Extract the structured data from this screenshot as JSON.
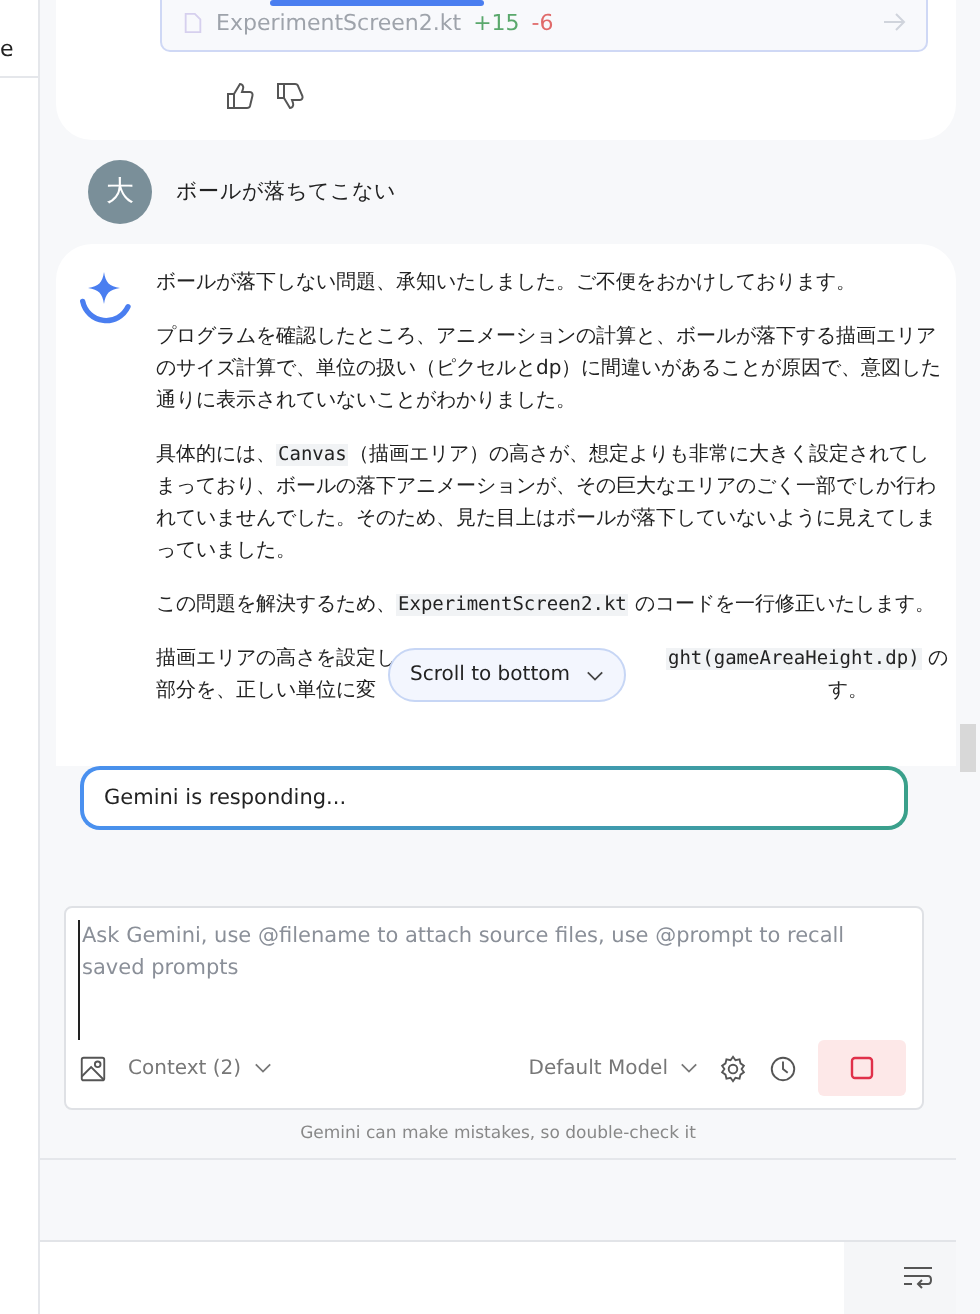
{
  "sidebar": {
    "label": "e"
  },
  "previous_reply": {
    "file": {
      "name": "ExperimentScreen2.kt",
      "added": "+15",
      "removed": "-6"
    }
  },
  "user_message": {
    "avatar": "大",
    "text": "ボールが落ちてこない"
  },
  "reply": {
    "paragraphs": [
      [
        {
          "kind": "text",
          "text": "ボールが落下しない問題、承知いたしました。ご不便をおかけしております。"
        }
      ],
      [
        {
          "kind": "text",
          "text": "プログラムを確認したところ、アニメーションの計算と、ボールが落下する描画エリアのサイズ計算で、単位の扱い（ピクセルとdp）に間違いがあることが原因で、意図した通りに表示されていないことがわかりました。"
        }
      ],
      [
        {
          "kind": "text",
          "text": "具体的には、"
        },
        {
          "kind": "code",
          "text": "Canvas"
        },
        {
          "kind": "text",
          "text": "（描画エリア）の高さが、想定よりも非常に大きく設定されてしまっており、ボールの落下アニメーションが、その巨大なエリアのごく一部でしか行われていませんでした。そのため、見た目上はボールが落下していないように見えてしまっていました。"
        }
      ],
      [
        {
          "kind": "text",
          "text": "この問題を解決するため、"
        },
        {
          "kind": "code",
          "text": "ExperimentScreen2.kt"
        },
        {
          "kind": "text",
          "text": " のコードを一行修正いたします。"
        }
      ]
    ],
    "covered_lines": [
      {
        "left": [
          {
            "kind": "text",
            "text": "描画エリアの高さを設定し"
          }
        ],
        "right": [
          {
            "kind": "code",
            "text": "ght(gameAreaHeight.dp)"
          },
          {
            "kind": "text",
            "text": " の"
          }
        ]
      },
      {
        "left": [
          {
            "kind": "text",
            "text": "部分を、正しい単位に変"
          }
        ],
        "right": [
          {
            "kind": "text",
            "text": "す。"
          }
        ]
      }
    ],
    "scroll_button": "Scroll to bottom"
  },
  "status": "Gemini is responding...",
  "composer": {
    "placeholder": "Ask Gemini, use @filename to attach source files, use @prompt to recall saved prompts",
    "context": "Context (2)",
    "model": "Default Model"
  },
  "disclaimer": "Gemini can make mistakes, so double-check it"
}
